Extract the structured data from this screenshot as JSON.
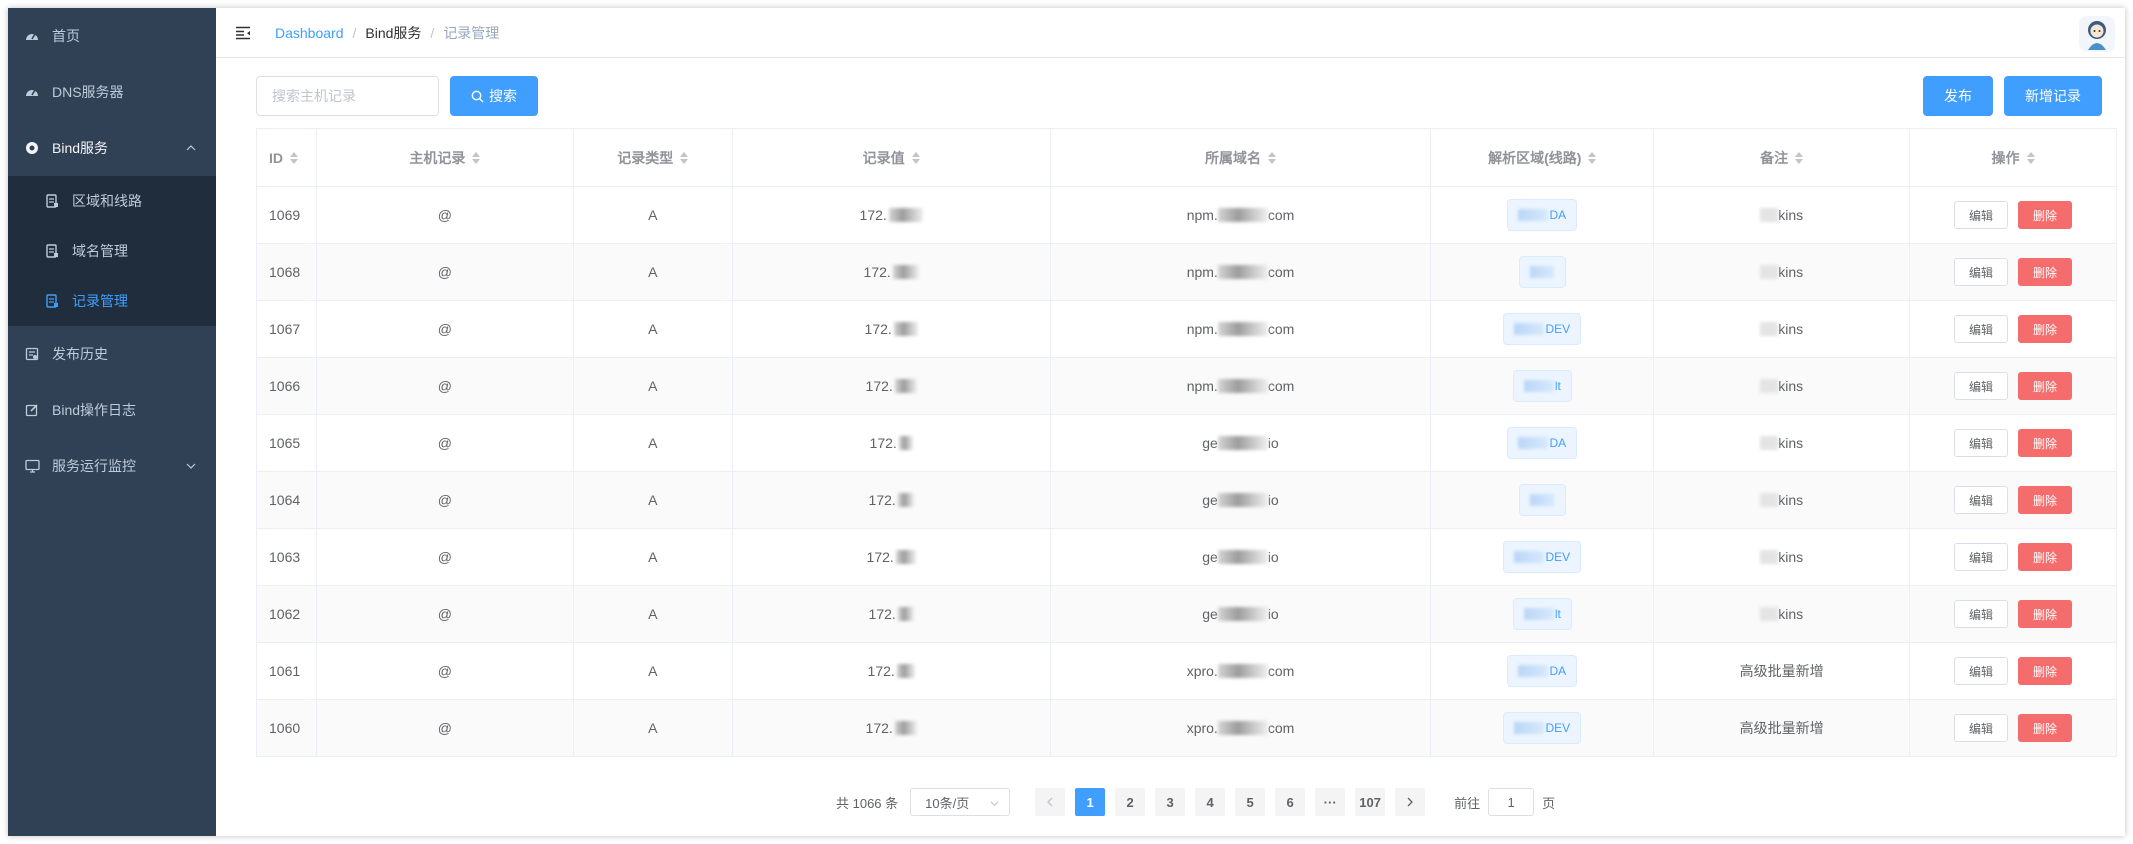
{
  "sidebar": {
    "items": [
      {
        "label": "首页",
        "icon": "dashboard-icon"
      },
      {
        "label": "DNS服务器",
        "icon": "dashboard-icon"
      },
      {
        "label": "Bind服务",
        "icon": "lifebuoy-icon",
        "expanded": true
      },
      {
        "label": "发布历史",
        "icon": "history-icon"
      },
      {
        "label": "Bind操作日志",
        "icon": "edit-log-icon"
      },
      {
        "label": "服务运行监控",
        "icon": "monitor-icon"
      }
    ],
    "submenu": [
      {
        "label": "区域和线路",
        "icon": "document-icon"
      },
      {
        "label": "域名管理",
        "icon": "document-icon"
      },
      {
        "label": "记录管理",
        "icon": "document-icon",
        "active": true
      }
    ]
  },
  "breadcrumb": [
    "Dashboard",
    "Bind服务",
    "记录管理"
  ],
  "toolbar": {
    "search_placeholder": "搜索主机记录",
    "search_label": "搜索",
    "publish_label": "发布",
    "add_label": "新增记录"
  },
  "table": {
    "columns": [
      "ID",
      "主机记录",
      "记录类型",
      "记录值",
      "所属域名",
      "解析区域(线路)",
      "备注",
      "操作"
    ],
    "edit_label": "编辑",
    "delete_label": "删除",
    "rows": [
      {
        "id": "1069",
        "host": "@",
        "type": "A",
        "value": "172.",
        "domain_prefix": "npm.",
        "domain_suffix": "com",
        "zone": "DA",
        "remark": "kins"
      },
      {
        "id": "1068",
        "host": "@",
        "type": "A",
        "value": "172.",
        "domain_prefix": "npm.",
        "domain_suffix": "com",
        "zone": "",
        "remark": "kins"
      },
      {
        "id": "1067",
        "host": "@",
        "type": "A",
        "value": "172.",
        "domain_prefix": "npm.",
        "domain_suffix": "com",
        "zone": "DEV",
        "remark": "kins"
      },
      {
        "id": "1066",
        "host": "@",
        "type": "A",
        "value": "172.",
        "domain_prefix": "npm.",
        "domain_suffix": "com",
        "zone": "lt",
        "remark": "kins"
      },
      {
        "id": "1065",
        "host": "@",
        "type": "A",
        "value": "172.",
        "domain_prefix": "ge",
        "domain_suffix": "io",
        "zone": "DA",
        "remark": "kins"
      },
      {
        "id": "1064",
        "host": "@",
        "type": "A",
        "value": "172.",
        "domain_prefix": "ge",
        "domain_suffix": "io",
        "zone": "",
        "remark": "kins"
      },
      {
        "id": "1063",
        "host": "@",
        "type": "A",
        "value": "172.",
        "domain_prefix": "ge",
        "domain_suffix": "io",
        "zone": "DEV",
        "remark": "kins"
      },
      {
        "id": "1062",
        "host": "@",
        "type": "A",
        "value": "172.",
        "domain_prefix": "ge",
        "domain_suffix": "io",
        "zone": "lt",
        "remark": "kins"
      },
      {
        "id": "1061",
        "host": "@",
        "type": "A",
        "value": "172.",
        "domain_prefix": "xpro.",
        "domain_suffix": "com",
        "zone": "DA",
        "remark": "高级批量新增"
      },
      {
        "id": "1060",
        "host": "@",
        "type": "A",
        "value": "172.",
        "domain_prefix": "xpro.",
        "domain_suffix": "com",
        "zone": "DEV",
        "remark": "高级批量新增"
      }
    ]
  },
  "pagination": {
    "total_text": "共 1066 条",
    "page_size": "10条/页",
    "pages": [
      "1",
      "2",
      "3",
      "4",
      "5",
      "6",
      "···",
      "107"
    ],
    "current": "1",
    "goto_label": "前往",
    "goto_value": "1",
    "page_unit": "页"
  },
  "colors": {
    "sidebar_bg": "#304156",
    "submenu_bg": "#1f2d3d",
    "accent": "#409eff",
    "danger": "#f56c6c"
  }
}
